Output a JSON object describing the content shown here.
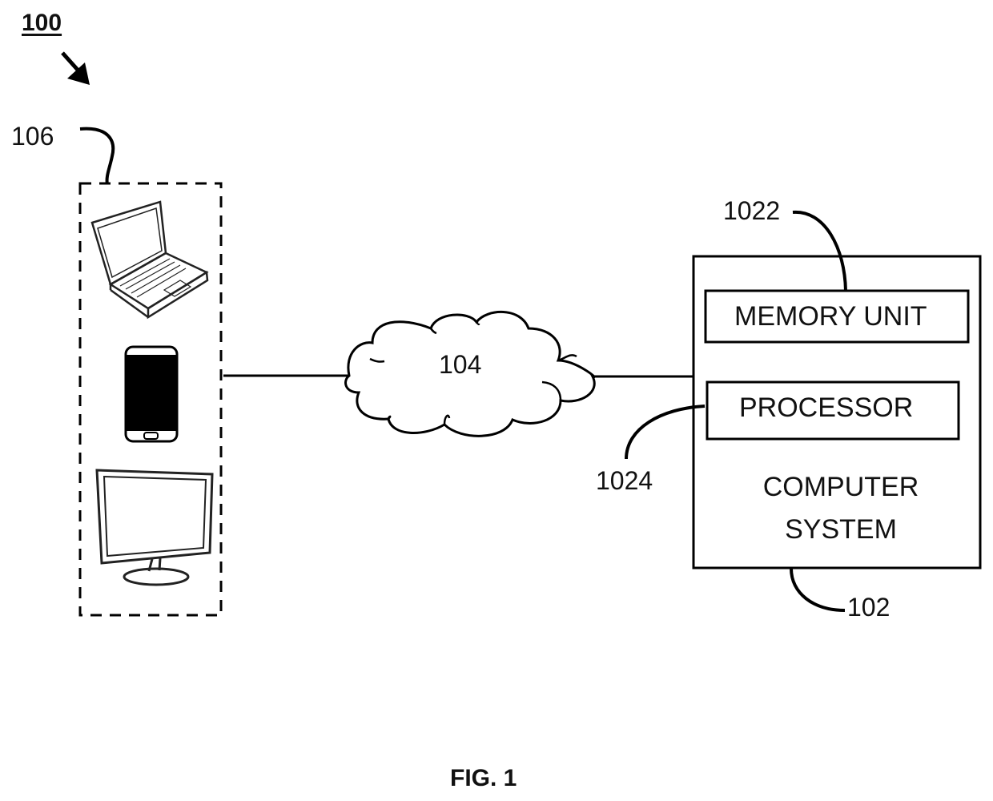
{
  "figure": {
    "system_ref": "100",
    "caption": "FIG. 1"
  },
  "devices_group": {
    "ref": "106",
    "devices": [
      {
        "name": "laptop",
        "icon": "laptop-icon"
      },
      {
        "name": "smartphone",
        "icon": "smartphone-icon"
      },
      {
        "name": "desktop monitor",
        "icon": "monitor-icon"
      }
    ]
  },
  "network": {
    "ref": "104",
    "icon": "cloud-icon"
  },
  "computer_system": {
    "ref": "102",
    "label_line1": "COMPUTER",
    "label_line2": "SYSTEM",
    "memory_unit": {
      "ref": "1022",
      "label": "MEMORY UNIT"
    },
    "processor": {
      "ref": "1024",
      "label": "PROCESSOR"
    }
  }
}
